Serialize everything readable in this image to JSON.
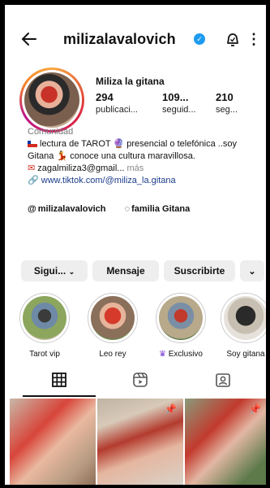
{
  "header": {
    "username": "milizalavalovich"
  },
  "profile": {
    "display_name": "Miliza la gitana",
    "stats": [
      {
        "value": "294",
        "label": "publicaci..."
      },
      {
        "value": "109...",
        "label": "seguid..."
      },
      {
        "value": "210",
        "label": "seg..."
      }
    ],
    "category": "Comunidad",
    "bio_line1": "lectura de TAROT 🔮 presencial o telefónica ..soy",
    "bio_line2": "Gitana 💃 conoce una cultura maravillosa.",
    "bio_email": "zagalmiliza3@gmail...",
    "bio_more": "más",
    "link": "www.tiktok.com/@miliza_la.gitana",
    "threads_handle": "milizalavalovich",
    "community_label": "familia Gitana"
  },
  "buttons": {
    "following": "Sigui...",
    "message": "Mensaje",
    "subscribe": "Suscribirte"
  },
  "highlights": [
    {
      "label": "Tarot vip"
    },
    {
      "label": "Leo rey"
    },
    {
      "label": "Exclusivo"
    },
    {
      "label": "Soy gitana"
    }
  ],
  "colors": {
    "verified": "#1d9bf0",
    "link": "#1a3b8a",
    "exclusive_crown": "#7a3fd1"
  }
}
